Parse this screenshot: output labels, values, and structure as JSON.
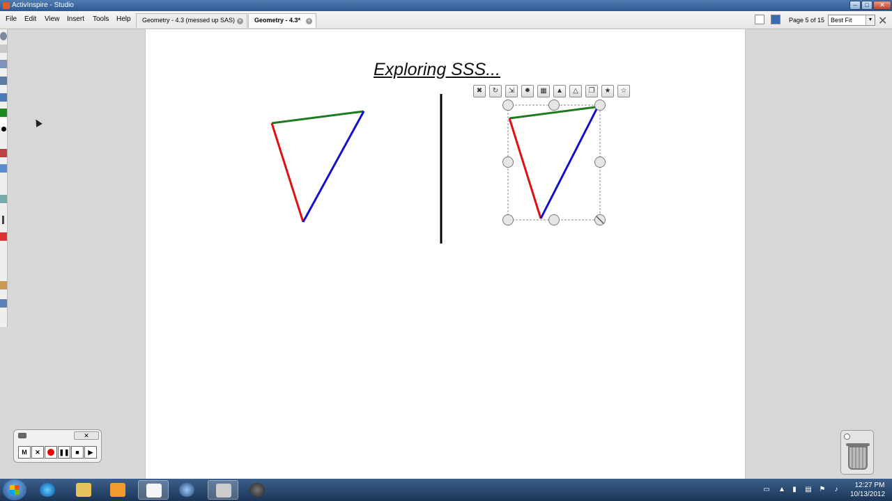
{
  "window": {
    "title": "ActivInspire - Studio"
  },
  "menu": [
    "File",
    "Edit",
    "View",
    "Insert",
    "Tools",
    "Help"
  ],
  "tabs": [
    {
      "label": "Geometry - 4.3 (messed up SAS)",
      "active": false
    },
    {
      "label": "Geometry - 4.3*",
      "active": true
    }
  ],
  "page_indicator": "Page 5 of 15",
  "zoom": {
    "value": "Best Fit"
  },
  "page": {
    "title": "Exploring SSS...",
    "colors": {
      "top_side": "#1e7a1e",
      "left_side": "#e01010",
      "right_side": "#1010cc"
    }
  },
  "object_toolbar": [
    "delete-icon",
    "rotate-icon",
    "resize-icon",
    "color-icon",
    "layer-front-icon",
    "layer-up-icon",
    "layer-down-icon",
    "copy-icon",
    "favorite-icon",
    "menu-icon"
  ],
  "recorder": {
    "buttons": [
      "M",
      "✕",
      "",
      "❚❚",
      "■",
      "▶"
    ],
    "close": "✕"
  },
  "taskbar": {
    "apps": [
      "ie-icon",
      "explorer-icon",
      "media-player-icon",
      "activinspire-icon",
      "dell-icon",
      "tool-icon",
      "camera-icon"
    ],
    "clock_time": "12:27 PM",
    "clock_date": "10/13/2012"
  }
}
